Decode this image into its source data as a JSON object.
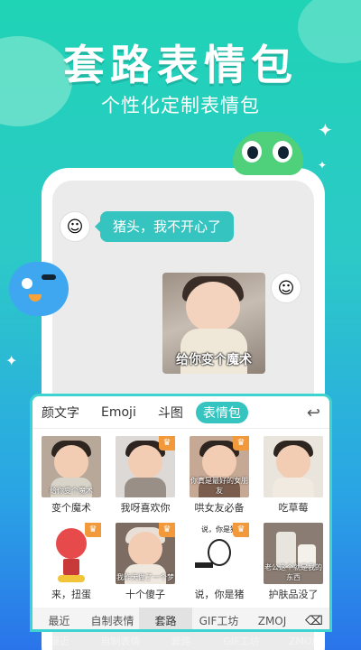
{
  "promo": {
    "title": "套路表情包",
    "subtitle": "个性化定制表情包"
  },
  "chat": {
    "left_message": "猪头，我不开心了",
    "sticker_caption": "给你变个魔术"
  },
  "keyboard": {
    "tabs": [
      "颜文字",
      "Emoji",
      "斗图",
      "表情包"
    ],
    "active_tab": "表情包",
    "back_icon": "back-arrow-icon",
    "stickers": [
      {
        "label": "变个魔术",
        "caption": "给你变个魔术",
        "crown": false
      },
      {
        "label": "我呀喜欢你",
        "caption": "",
        "crown": true
      },
      {
        "label": "哄女友必备",
        "caption": "你真是最好的女朋友",
        "crown": true
      },
      {
        "label": "吃草莓",
        "caption": "",
        "crown": false
      },
      {
        "label": "来，扭蛋",
        "caption": "",
        "crown": true
      },
      {
        "label": "十个傻子",
        "caption": "我昨天做了一个梦",
        "crown": true
      },
      {
        "label": "说，你是猪",
        "caption": "说，你是猪",
        "crown": true
      },
      {
        "label": "护肤品没了",
        "caption": "老公这个就是我的东西",
        "crown": false
      }
    ],
    "bottom_tabs": [
      "最近",
      "自制表情",
      "套路",
      "GIF工坊",
      "ZMOJ"
    ],
    "active_bottom_tab": "套路",
    "delete_icon": "backspace-icon"
  },
  "ghost_bar": [
    "最近",
    "自制表情",
    "套路",
    "GIF工坊",
    "ZMOJ"
  ],
  "colors": {
    "accent": "#35c4c0",
    "crown": "#f29a3b"
  }
}
